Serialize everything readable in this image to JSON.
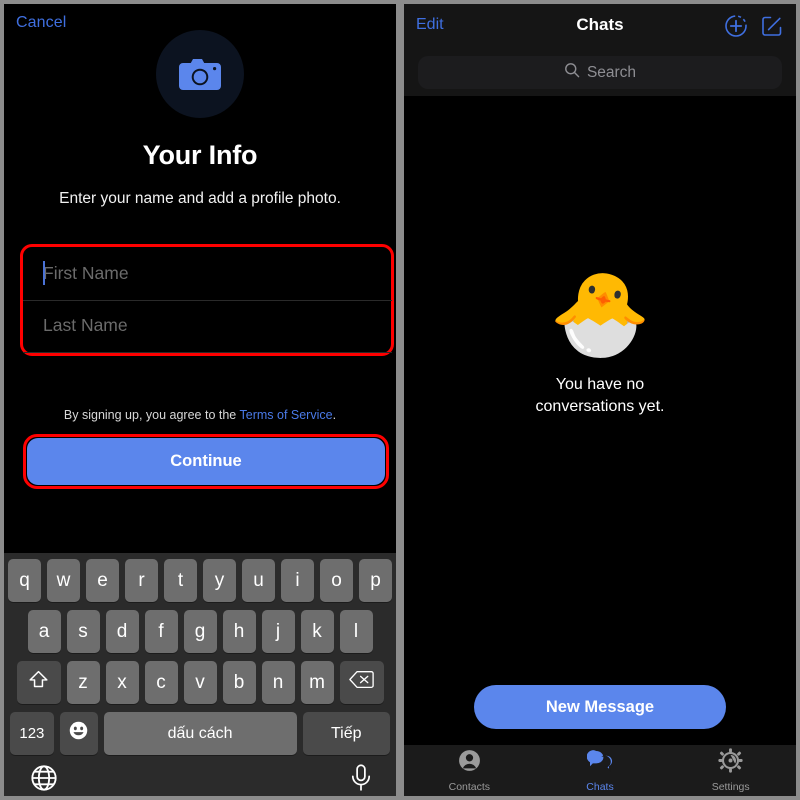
{
  "signup": {
    "cancel_label": "Cancel",
    "avatar_icon": "camera-icon",
    "title": "Your Info",
    "subtitle": "Enter your name and add a profile photo.",
    "first_name_placeholder": "First Name",
    "first_name_value": "",
    "last_name_placeholder": "Last Name",
    "last_name_value": "",
    "terms_prefix": "By signing up, you agree to the ",
    "terms_link": "Terms of Service",
    "terms_suffix": ".",
    "continue_label": "Continue",
    "highlight_color": "#ff0000",
    "accent_color": "#5b86ec"
  },
  "keyboard": {
    "language": "Vietnamese",
    "row1": [
      "q",
      "w",
      "e",
      "r",
      "t",
      "y",
      "u",
      "i",
      "o",
      "p"
    ],
    "row2": [
      "a",
      "s",
      "d",
      "f",
      "g",
      "h",
      "j",
      "k",
      "l"
    ],
    "row3": [
      "z",
      "x",
      "c",
      "v",
      "b",
      "n",
      "m"
    ],
    "shift_icon": "shift-up-arrow-icon",
    "delete_icon": "backspace-icon",
    "numbers_label": "123",
    "emoji_icon": "smiley-face-icon",
    "space_label": "dấu cách",
    "next_label": "Tiếp",
    "globe_icon": "globe-icon",
    "mic_icon": "microphone-icon",
    "key_color": "#6e6e6e",
    "modifier_key_color": "#4a4a4a",
    "background_color": "#2b2b2b"
  },
  "chats": {
    "edit_label": "Edit",
    "title": "Chats",
    "add_contact_icon": "add-person-circle-icon",
    "compose_icon": "compose-square-pencil-icon",
    "search_icon": "search-icon",
    "search_placeholder": "Search",
    "search_value": "",
    "empty_emoji": "🐣",
    "empty_text_line1": "You have no",
    "empty_text_line2": "conversations yet.",
    "new_message_label": "New Message",
    "tabs": [
      {
        "label": "Contacts",
        "icon": "person-circle-icon",
        "active": false
      },
      {
        "label": "Chats",
        "icon": "chat-bubbles-icon",
        "active": true
      },
      {
        "label": "Settings",
        "icon": "gear-icon",
        "active": false
      }
    ],
    "accent_color": "#5b86ec",
    "navbar_color": "#151515",
    "tabbar_color": "#1b1b1b"
  }
}
